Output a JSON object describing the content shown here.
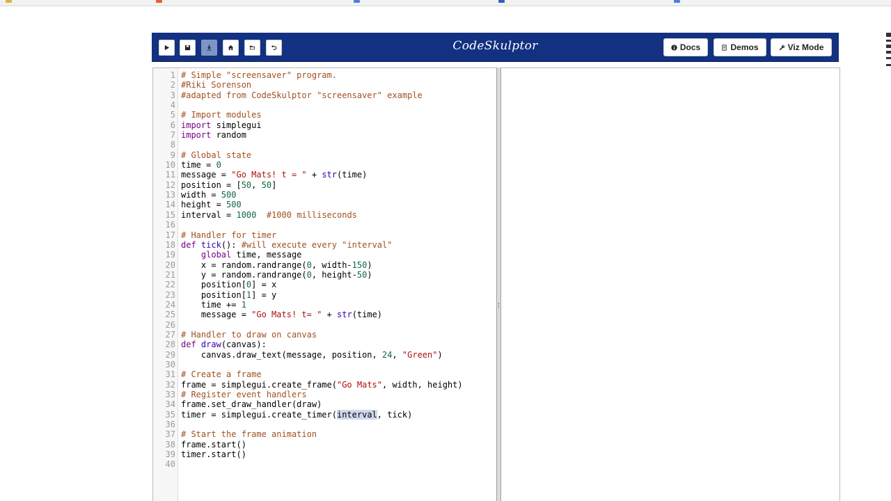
{
  "app": {
    "title": "CodeSkulptor",
    "colors": {
      "header_bg": "#133181",
      "comment": "#a0501e",
      "keyword": "#770088",
      "string": "#aa1111",
      "number": "#116644",
      "builtin": "#3300aa"
    }
  },
  "toolbar": {
    "tools": [
      {
        "name": "run-button",
        "icon": "play-icon",
        "active": false
      },
      {
        "name": "save-button",
        "icon": "save-icon",
        "active": false
      },
      {
        "name": "download-button",
        "icon": "download-icon",
        "active": true
      },
      {
        "name": "fresh-url-button",
        "icon": "home-icon",
        "active": false
      },
      {
        "name": "open-button",
        "icon": "folder-icon",
        "active": false
      },
      {
        "name": "reset-button",
        "icon": "undo-icon",
        "active": false
      }
    ],
    "docs_label": "Docs",
    "demos_label": "Demos",
    "vizmode_label": "Viz Mode"
  },
  "editor": {
    "lines": [
      [
        [
          "c",
          "# Simple \"screensaver\" program."
        ]
      ],
      [
        [
          "c",
          "#Riki Sorenson"
        ]
      ],
      [
        [
          "c",
          "#adapted from CodeSkulptor \"screensaver\" example"
        ]
      ],
      [],
      [
        [
          "c",
          "# Import modules"
        ]
      ],
      [
        [
          "k",
          "import"
        ],
        [
          "p",
          " simplegui"
        ]
      ],
      [
        [
          "k",
          "import"
        ],
        [
          "p",
          " random"
        ]
      ],
      [],
      [
        [
          "c",
          "# Global state"
        ]
      ],
      [
        [
          "p",
          "time = "
        ],
        [
          "n",
          "0"
        ]
      ],
      [
        [
          "p",
          "message = "
        ],
        [
          "s",
          "\"Go Mats! t = \""
        ],
        [
          "p",
          " + "
        ],
        [
          "b",
          "str"
        ],
        [
          "p",
          "(time)"
        ]
      ],
      [
        [
          "p",
          "position = ["
        ],
        [
          "n",
          "50"
        ],
        [
          "p",
          ", "
        ],
        [
          "n",
          "50"
        ],
        [
          "p",
          "]"
        ]
      ],
      [
        [
          "p",
          "width = "
        ],
        [
          "n",
          "500"
        ]
      ],
      [
        [
          "p",
          "height = "
        ],
        [
          "n",
          "500"
        ]
      ],
      [
        [
          "p",
          "interval = "
        ],
        [
          "n",
          "1000"
        ],
        [
          "p",
          "  "
        ],
        [
          "c",
          "#1000 milliseconds"
        ]
      ],
      [],
      [
        [
          "c",
          "# Handler for timer"
        ]
      ],
      [
        [
          "k",
          "def"
        ],
        [
          "p",
          " "
        ],
        [
          "b",
          "tick"
        ],
        [
          "p",
          "(): "
        ],
        [
          "c",
          "#will execute every \"interval\""
        ]
      ],
      [
        [
          "p",
          "    "
        ],
        [
          "k",
          "global"
        ],
        [
          "p",
          " time, message"
        ]
      ],
      [
        [
          "p",
          "    x = random.randrange("
        ],
        [
          "n",
          "0"
        ],
        [
          "p",
          ", width-"
        ],
        [
          "n",
          "150"
        ],
        [
          "p",
          ")"
        ]
      ],
      [
        [
          "p",
          "    y = random.randrange("
        ],
        [
          "n",
          "0"
        ],
        [
          "p",
          ", height-"
        ],
        [
          "n",
          "50"
        ],
        [
          "p",
          ")"
        ]
      ],
      [
        [
          "p",
          "    position["
        ],
        [
          "n",
          "0"
        ],
        [
          "p",
          "] = x"
        ]
      ],
      [
        [
          "p",
          "    position["
        ],
        [
          "n",
          "1"
        ],
        [
          "p",
          "] = y"
        ]
      ],
      [
        [
          "p",
          "    time += "
        ],
        [
          "n",
          "1"
        ]
      ],
      [
        [
          "p",
          "    message = "
        ],
        [
          "s",
          "\"Go Mats! t= \""
        ],
        [
          "p",
          " + "
        ],
        [
          "b",
          "str"
        ],
        [
          "p",
          "(time)"
        ]
      ],
      [],
      [
        [
          "c",
          "# Handler to draw on canvas"
        ]
      ],
      [
        [
          "k",
          "def"
        ],
        [
          "p",
          " "
        ],
        [
          "b",
          "draw"
        ],
        [
          "p",
          "(canvas):"
        ]
      ],
      [
        [
          "p",
          "    canvas.draw_text(message, position, "
        ],
        [
          "n",
          "24"
        ],
        [
          "p",
          ", "
        ],
        [
          "s",
          "\"Green\""
        ],
        [
          "p",
          ")"
        ]
      ],
      [],
      [
        [
          "c",
          "# Create a frame"
        ]
      ],
      [
        [
          "p",
          "frame = simplegui.create_frame("
        ],
        [
          "s",
          "\"Go Mats\""
        ],
        [
          "p",
          ", width, height)"
        ]
      ],
      [
        [
          "c",
          "# Register event handlers"
        ]
      ],
      [
        [
          "p",
          "frame.set_draw_handler(draw)"
        ]
      ],
      [
        [
          "p",
          "timer = simplegui.create_timer("
        ],
        [
          "h",
          "interval"
        ],
        [
          "p",
          ", tick)"
        ]
      ],
      [],
      [
        [
          "c",
          "# Start the frame animation"
        ]
      ],
      [
        [
          "p",
          "frame.start()"
        ]
      ],
      [
        [
          "p",
          "timer.start()"
        ]
      ],
      []
    ]
  }
}
